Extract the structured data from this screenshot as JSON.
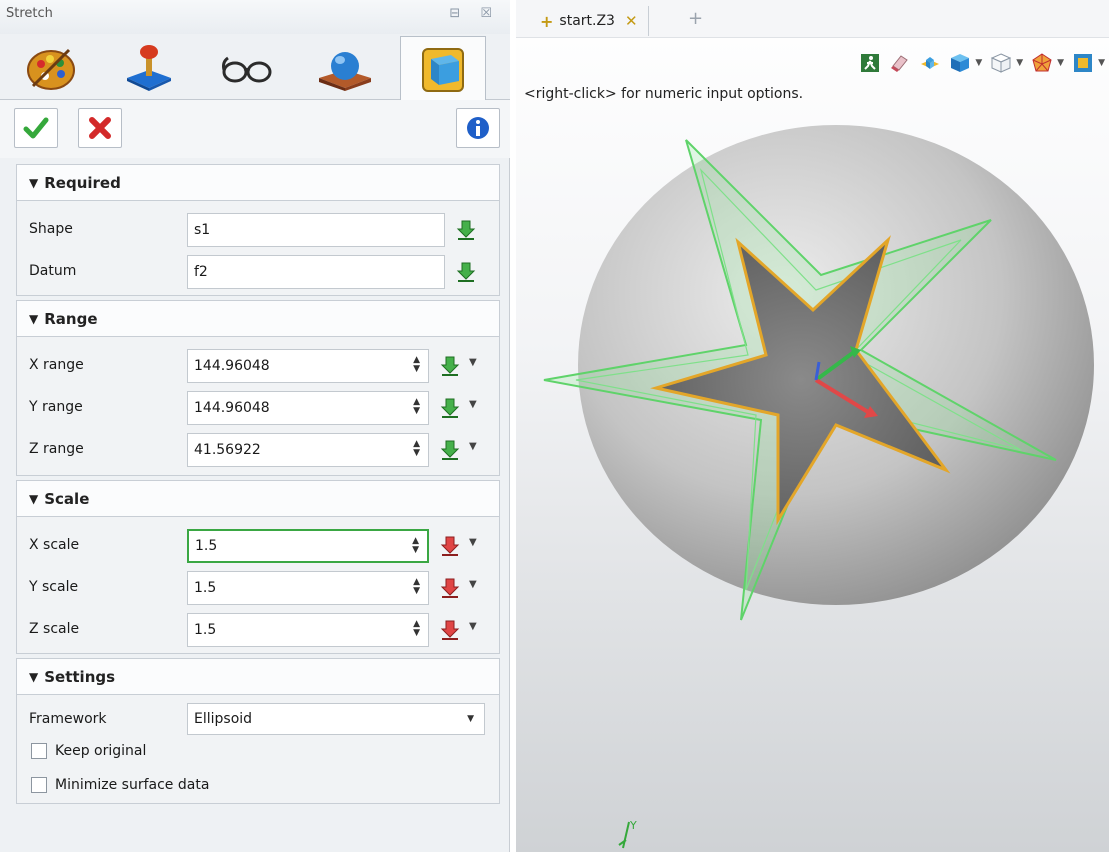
{
  "panel": {
    "title": "Stretch",
    "controls": "⊟ ☒",
    "tool_tabs": [
      "paint-palette-icon",
      "joystick-icon",
      "glasses-icon",
      "sphere-on-surface-icon",
      "stretch-cube-icon"
    ],
    "active_tab": 4
  },
  "actions": {
    "ok_icon": "green-check-icon",
    "cancel_icon": "red-x-icon",
    "info_icon": "info-icon"
  },
  "required": {
    "header": "Required",
    "shape_label": "Shape",
    "shape_value": "s1",
    "datum_label": "Datum",
    "datum_value": "f2"
  },
  "range": {
    "header": "Range",
    "rows": [
      {
        "label": "X range",
        "value": "144.96048"
      },
      {
        "label": "Y range",
        "value": "144.96048"
      },
      {
        "label": "Z range",
        "value": "41.56922"
      }
    ]
  },
  "scale": {
    "header": "Scale",
    "rows": [
      {
        "label": "X scale",
        "value": "1.5"
      },
      {
        "label": "Y scale",
        "value": "1.5"
      },
      {
        "label": "Z scale",
        "value": "1.5"
      }
    ]
  },
  "settings": {
    "header": "Settings",
    "framework_label": "Framework",
    "framework_value": "Ellipsoid",
    "keep_original": "Keep original",
    "minimize_surface": "Minimize surface data"
  },
  "view": {
    "tab_label": "start.Z3",
    "hint": "<right-click> for numeric input options.",
    "axis_label": "Y",
    "colors": {
      "sphere": "#a9a9a9",
      "wireframe": "#5fd36a",
      "star": "#6f6f6f",
      "accent_edge": "#e3a629",
      "check_green": "#3aa743"
    }
  }
}
